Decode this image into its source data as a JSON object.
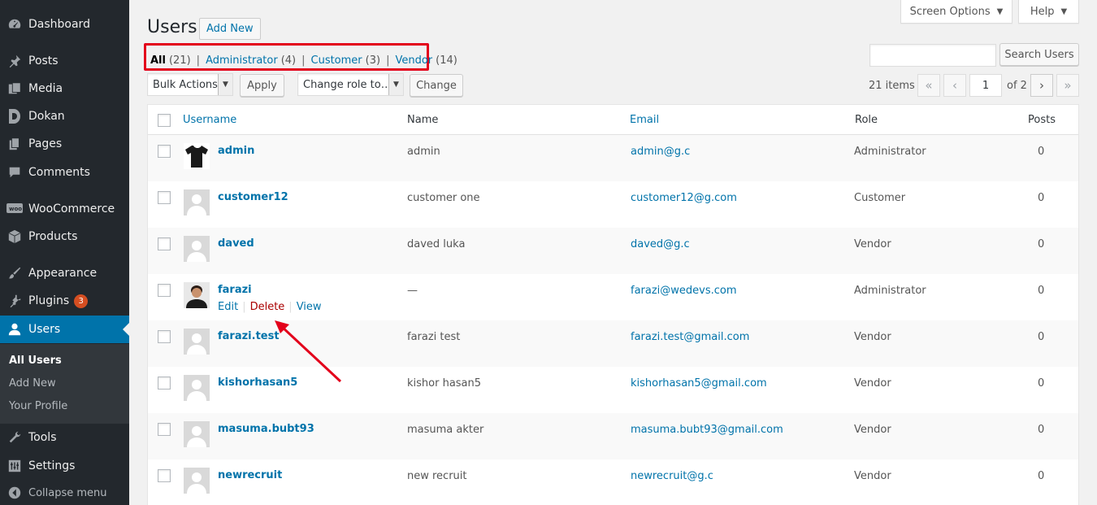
{
  "sidebar": {
    "items": [
      {
        "label": "Dashboard",
        "icon": "dashboard-icon"
      },
      {
        "label": "Posts",
        "icon": "pin-icon"
      },
      {
        "label": "Media",
        "icon": "media-icon"
      },
      {
        "label": "Dokan",
        "icon": "dokan-icon"
      },
      {
        "label": "Pages",
        "icon": "pages-icon"
      },
      {
        "label": "Comments",
        "icon": "comment-icon"
      },
      {
        "label": "WooCommerce",
        "icon": "woo-icon"
      },
      {
        "label": "Products",
        "icon": "box-icon"
      },
      {
        "label": "Appearance",
        "icon": "brush-icon"
      },
      {
        "label": "Plugins",
        "icon": "plug-icon",
        "badge": "3"
      },
      {
        "label": "Users",
        "icon": "user-icon"
      },
      {
        "label": "Tools",
        "icon": "wrench-icon"
      },
      {
        "label": "Settings",
        "icon": "settings-icon"
      },
      {
        "label": "Collapse menu",
        "icon": "collapse-icon"
      }
    ],
    "submenu": [
      "All Users",
      "Add New",
      "Your Profile"
    ]
  },
  "header": {
    "screen_options": "Screen Options",
    "help": "Help",
    "title": "Users",
    "add_new": "Add New"
  },
  "filters": {
    "all": {
      "label": "All",
      "count": "(21)"
    },
    "administrator": {
      "label": "Administrator",
      "count": "(4)"
    },
    "customer": {
      "label": "Customer",
      "count": "(3)"
    },
    "vendor": {
      "label": "Vendor",
      "count": "(14)"
    },
    "separator": "|"
  },
  "toolbar": {
    "bulk_actions": "Bulk Actions",
    "apply": "Apply",
    "change_role": "Change role to…",
    "change": "Change",
    "search_button": "Search Users",
    "items_count": "21 items",
    "current_page": "1",
    "of_pages": "of 2",
    "first": "«",
    "prev": "‹",
    "next": "›",
    "last": "»"
  },
  "table": {
    "columns": {
      "username": "Username",
      "name": "Name",
      "email": "Email",
      "role": "Role",
      "posts": "Posts"
    },
    "rows": [
      {
        "username": "admin",
        "name": "admin",
        "email": "admin@g.c",
        "role": "Administrator",
        "posts": "0"
      },
      {
        "username": "customer12",
        "name": "customer one",
        "email": "customer12@g.com",
        "role": "Customer",
        "posts": "0"
      },
      {
        "username": "daved",
        "name": "daved luka",
        "email": "daved@g.c",
        "role": "Vendor",
        "posts": "0"
      },
      {
        "username": "farazi",
        "name": "—",
        "email": "farazi@wedevs.com",
        "role": "Administrator",
        "posts": "0"
      },
      {
        "username": "farazi.test",
        "name": "farazi test",
        "email": "farazi.test@gmail.com",
        "role": "Vendor",
        "posts": "0"
      },
      {
        "username": "kishorhasan5",
        "name": "kishor hasan5",
        "email": "kishorhasan5@gmail.com",
        "role": "Vendor",
        "posts": "0"
      },
      {
        "username": "masuma.bubt93",
        "name": "masuma akter",
        "email": "masuma.bubt93@gmail.com",
        "role": "Vendor",
        "posts": "0"
      },
      {
        "username": "newrecruit",
        "name": "new recruit",
        "email": "newrecruit@g.c",
        "role": "Vendor",
        "posts": "0"
      }
    ],
    "row_actions": {
      "edit": "Edit",
      "delete": "Delete",
      "view": "View",
      "separator": "|"
    }
  },
  "colors": {
    "sidebar_bg": "#23282d",
    "accent": "#0073aa",
    "highlight_box": "#e3001b",
    "delete": "#aa0000"
  }
}
